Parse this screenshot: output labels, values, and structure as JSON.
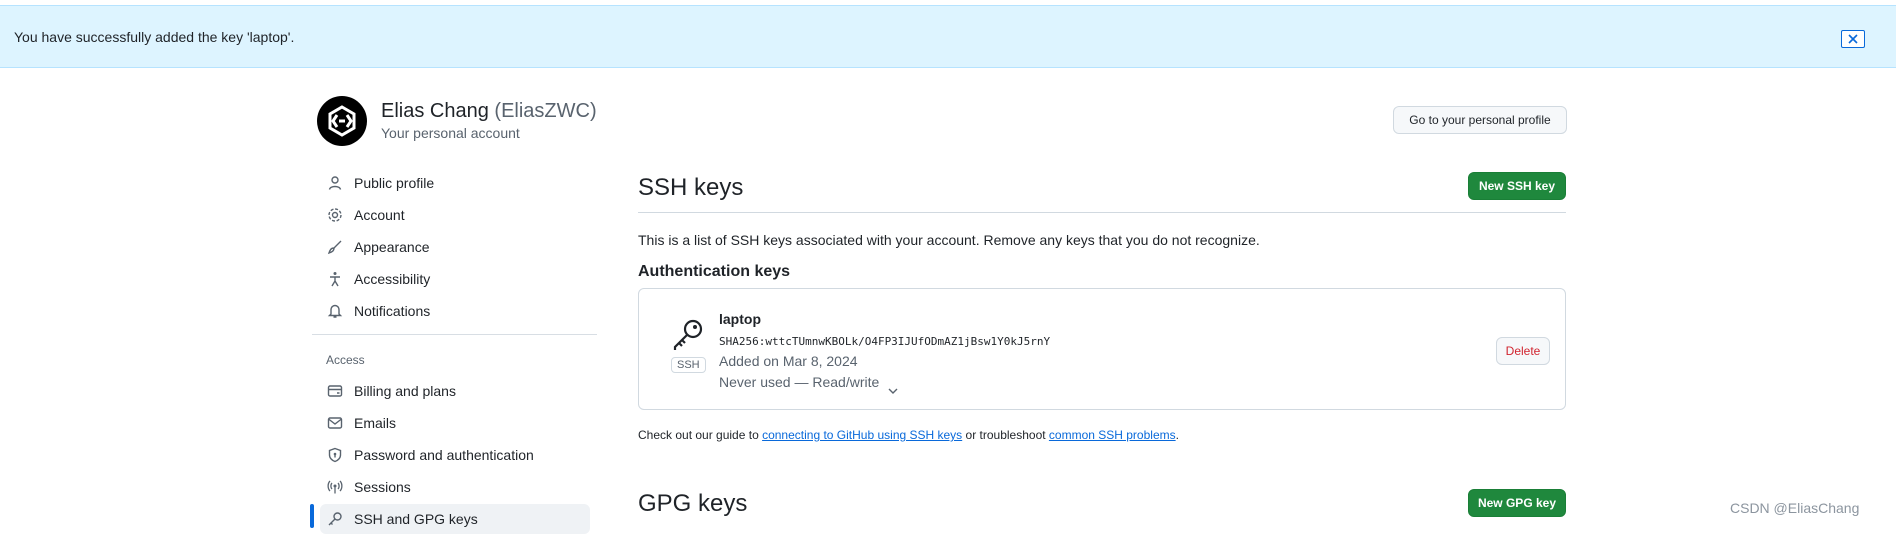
{
  "flash": {
    "message": "You have successfully added the key 'laptop'."
  },
  "user": {
    "name": "Elias Chang",
    "login": "(EliasZWC)",
    "subtitle": "Your personal account"
  },
  "header": {
    "profile_button": "Go to your personal profile"
  },
  "sidebar": {
    "items": [
      {
        "label": "Public profile",
        "icon": "person-icon"
      },
      {
        "label": "Account",
        "icon": "gear-icon"
      },
      {
        "label": "Appearance",
        "icon": "paintbrush-icon"
      },
      {
        "label": "Accessibility",
        "icon": "accessibility-icon"
      },
      {
        "label": "Notifications",
        "icon": "bell-icon"
      }
    ],
    "access_heading": "Access",
    "access_items": [
      {
        "label": "Billing and plans",
        "icon": "credit-card-icon"
      },
      {
        "label": "Emails",
        "icon": "mail-icon"
      },
      {
        "label": "Password and authentication",
        "icon": "shield-icon"
      },
      {
        "label": "Sessions",
        "icon": "broadcast-icon"
      },
      {
        "label": "SSH and GPG keys",
        "icon": "key-icon",
        "active": true
      }
    ]
  },
  "ssh": {
    "title": "SSH keys",
    "new_button": "New SSH key",
    "description": "This is a list of SSH keys associated with your account. Remove any keys that you do not recognize.",
    "auth_heading": "Authentication keys",
    "key": {
      "badge": "SSH",
      "title": "laptop",
      "fingerprint": "SHA256:wttcTUmnwKBOLk/O4FP3IJUfODmAZ1jBsw1Y0kJ5rnY",
      "added": "Added on Mar 8, 2024",
      "usage": "Never used — Read/write",
      "delete_label": "Delete"
    },
    "guide": {
      "prefix": "Check out our guide to ",
      "link1": "connecting to GitHub using SSH keys",
      "middle": " or troubleshoot ",
      "link2": "common SSH problems",
      "suffix": "."
    }
  },
  "gpg": {
    "title": "GPG keys",
    "new_button": "New GPG key"
  },
  "watermark": "CSDN @EliasChang",
  "colors": {
    "accent": "#0969da",
    "primary_button": "#1f883d",
    "flash_bg": "#ddf4ff",
    "danger": "#d1242f"
  }
}
